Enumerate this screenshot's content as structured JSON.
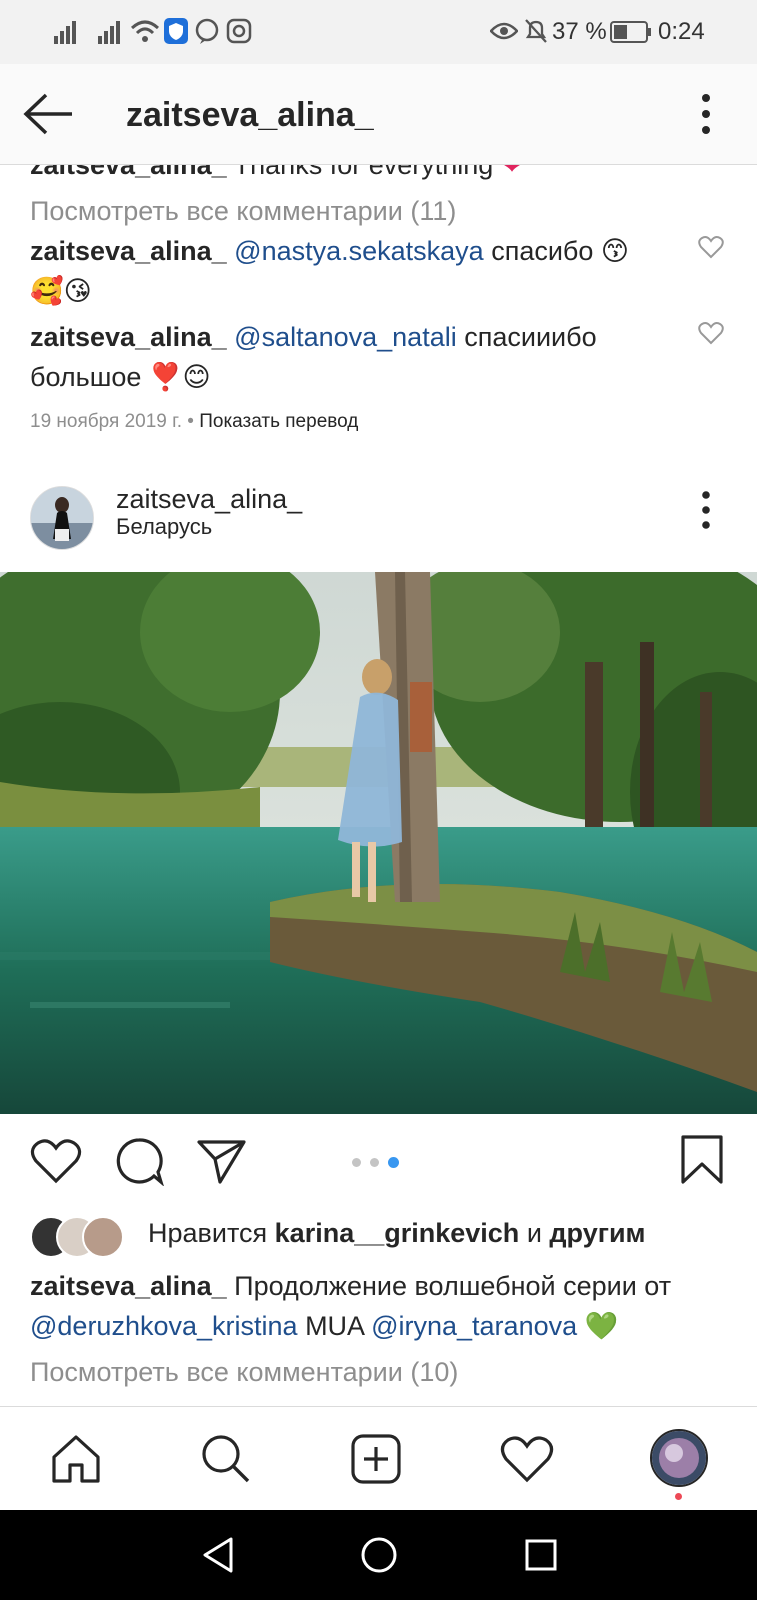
{
  "status_bar": {
    "battery": "37 %",
    "time": "0:24"
  },
  "header": {
    "title": "zaitseva_alina_"
  },
  "prev_post": {
    "partial_caption": {
      "user": "zaitseva_alina_",
      "text": "Thanks for everything"
    },
    "view_comments": "Посмотреть все комментарии (11)",
    "comments": [
      {
        "user": "zaitseva_alina_",
        "mention": "@nastya.sekatskaya",
        "text": "спасибо 😙",
        "text2": "🥰😘"
      },
      {
        "user": "zaitseva_alina_",
        "mention": "@saltanova_natali",
        "text": "спасииибо",
        "text2": "большое ❣️😊"
      }
    ],
    "date": "19 ноября 2019 г.",
    "translate_sep": "•",
    "translate": "Показать перевод"
  },
  "post": {
    "username": "zaitseva_alina_",
    "location": "Беларусь",
    "likes_prefix": "Нравится",
    "likes_user": "karina__grinkevich",
    "likes_and": "и",
    "likes_others": "другим",
    "caption_user": "zaitseva_alina_",
    "caption_text": "Продолжение волшебной серии от",
    "caption_mention1": "@deruzhkova_kristina",
    "caption_mua": "MUA",
    "caption_mention2": "@iryna_taranova",
    "caption_emoji": "💚",
    "view_comments": "Посмотреть все комментарии (10)",
    "carousel": {
      "count": 3,
      "active": 3
    }
  },
  "icons": {
    "back": "back-arrow-icon",
    "more": "more-vertical-icon",
    "like": "heart-icon",
    "comment": "comment-icon",
    "share": "send-icon",
    "save": "bookmark-icon",
    "home": "home-icon",
    "search": "search-icon",
    "add": "add-post-icon",
    "activity": "activity-heart-icon",
    "profile": "profile-avatar-icon"
  },
  "colors": {
    "mention": "#1f4e8c",
    "active_dot": "#3897f0",
    "muted": "#8e8e8e"
  }
}
